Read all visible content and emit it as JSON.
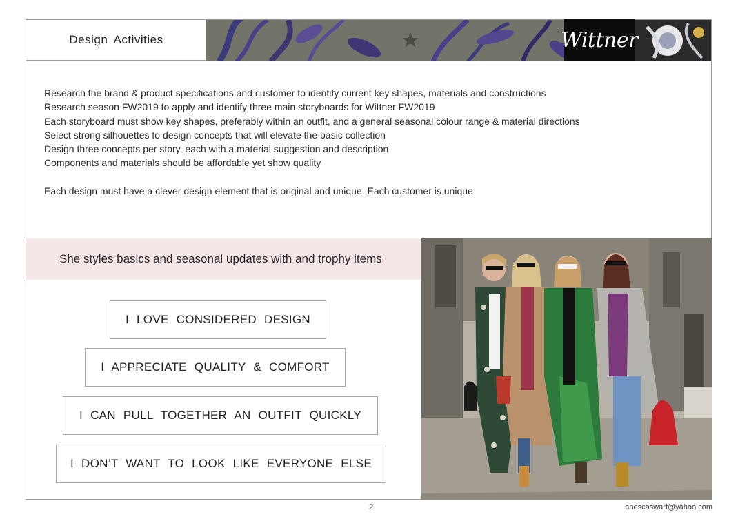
{
  "header": {
    "title": "Design  Activities",
    "brand_logo": "Wittner"
  },
  "activities": [
    "Research the brand & product specifications and customer to identify current key shapes, materials and constructions",
    "Research season FW2019 to apply and identify three main storyboards for Wittner FW2019",
    "Each storyboard must show key shapes, preferably within an outfit, and a general seasonal colour range & material directions",
    "Select strong silhouettes to design concepts that will elevate the basic collection",
    "Design three concepts per story, each with a material suggestion and description",
    "Components and materials should be affordable yet show quality"
  ],
  "note": "Each design must have a clever design element that is original and unique.  Each customer is unique",
  "customer": {
    "tagline": "She styles basics and seasonal updates with and trophy items",
    "statements": [
      "I  LOVE  CONSIDERED  DESIGN",
      "I  APPRECIATE  QUALITY  &  COMFORT",
      "I  CAN  PULL  TOGETHER  AN  OUTFIT  QUICKLY",
      "I  DON’T  WANT  TO  LOOK  LIKE  EVERYONE  ELSE"
    ]
  },
  "footer": {
    "page_number": "2",
    "email": "anescaswart@yahoo.com"
  },
  "colors": {
    "pink_band": "#f5e6e8",
    "logo_background": "#0c0c0c",
    "frame_border": "#9a9a9a"
  }
}
